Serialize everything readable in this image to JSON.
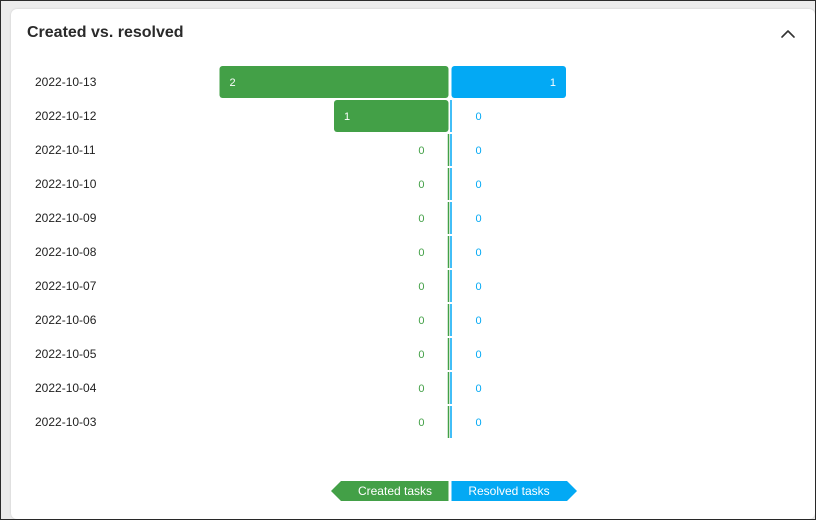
{
  "widget": {
    "title": "Created vs. resolved"
  },
  "icons": {
    "collapse": "chevron-up-icon"
  },
  "colors": {
    "created": "#43a047",
    "resolved": "#03a9f4"
  },
  "legend": {
    "created_label": "Created tasks",
    "resolved_label": "Resolved tasks"
  },
  "chart_data": {
    "type": "bar",
    "orientation": "horizontal-diverging",
    "categories": [
      "2022-10-13",
      "2022-10-12",
      "2022-10-11",
      "2022-10-10",
      "2022-10-09",
      "2022-10-08",
      "2022-10-07",
      "2022-10-06",
      "2022-10-05",
      "2022-10-04",
      "2022-10-03"
    ],
    "series": [
      {
        "name": "Created tasks",
        "values": [
          2,
          1,
          0,
          0,
          0,
          0,
          0,
          0,
          0,
          0,
          0
        ]
      },
      {
        "name": "Resolved tasks",
        "values": [
          1,
          0,
          0,
          0,
          0,
          0,
          0,
          0,
          0,
          0,
          0
        ]
      }
    ],
    "legend_position": "bottom-center"
  }
}
